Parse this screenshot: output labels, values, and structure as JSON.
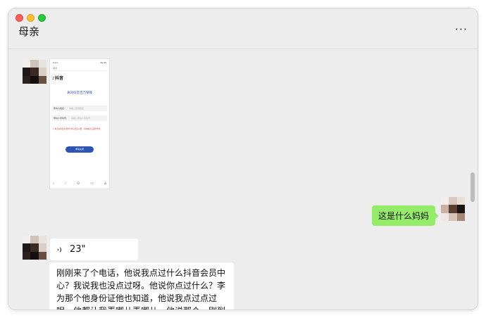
{
  "window": {
    "chat_title": "母亲",
    "more_icon": "more-icon",
    "more_glyph": "···"
  },
  "screenshot": {
    "status_left": "9:14",
    "status_right": "4G 95",
    "nav_label": "首页",
    "app_name": "抖音",
    "banner": "关闭抖音百万保障",
    "field1_label": "申请人姓名:",
    "field1_placeholder": "请输入您的姓名",
    "field2_label": "申请人手机号:",
    "field2_placeholder": "请输入申请人手机号",
    "notice": "1.本活动将会关闭用户抖音会员扣费，请在确认后提交申请",
    "button": "申请关闭",
    "bottom_icons": [
      "‹",
      "›",
      "⊙",
      "▭",
      "⌂"
    ]
  },
  "messages": {
    "sent_text": "这是什么妈妈",
    "voice_duration": "23\"",
    "text_received": "刚刚来了个电话，他说我点过什么抖音会员中心？我说我也没点过呀。他说你点过什么？李为那个他身份证他也知道，他说我点过点过呢，他都让我弄哪儿弄哪儿。他说那个。刚到"
  },
  "colors": {
    "sent_bubble": "#95ec69",
    "window_bg": "#ededed",
    "received_bubble": "#ffffff"
  }
}
